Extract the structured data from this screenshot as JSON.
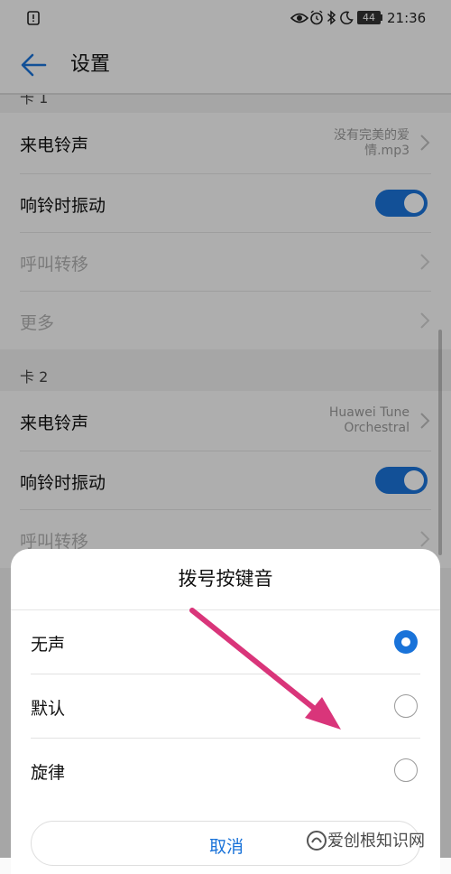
{
  "status_bar": {
    "time": "21:36",
    "battery": "44"
  },
  "header": {
    "title": "设置",
    "back_icon": "arrow-left-icon"
  },
  "sim1": {
    "section_label": "卡 1",
    "ringtone": {
      "label": "来电铃声",
      "value_line1": "没有完美的爱",
      "value_line2": "情.mp3"
    },
    "vibrate": {
      "label": "响铃时振动",
      "on": true
    },
    "forwarding": {
      "label": "呼叫转移"
    },
    "more": {
      "label": "更多"
    }
  },
  "sim2": {
    "section_label": "卡 2",
    "ringtone": {
      "label": "来电铃声",
      "value_line1": "Huawei Tune",
      "value_line2": "Orchestral"
    },
    "vibrate": {
      "label": "响铃时振动",
      "on": true
    },
    "forwarding": {
      "label": "呼叫转移"
    }
  },
  "dialog": {
    "title": "拨号按键音",
    "options": [
      {
        "label": "无声",
        "selected": true
      },
      {
        "label": "默认",
        "selected": false
      },
      {
        "label": "旋律",
        "selected": false
      }
    ],
    "cancel_label": "取消"
  },
  "watermark": {
    "text": "爱创根知识网"
  },
  "colors": {
    "accent": "#1a73d9",
    "annotation_arrow": "#d9357a"
  }
}
